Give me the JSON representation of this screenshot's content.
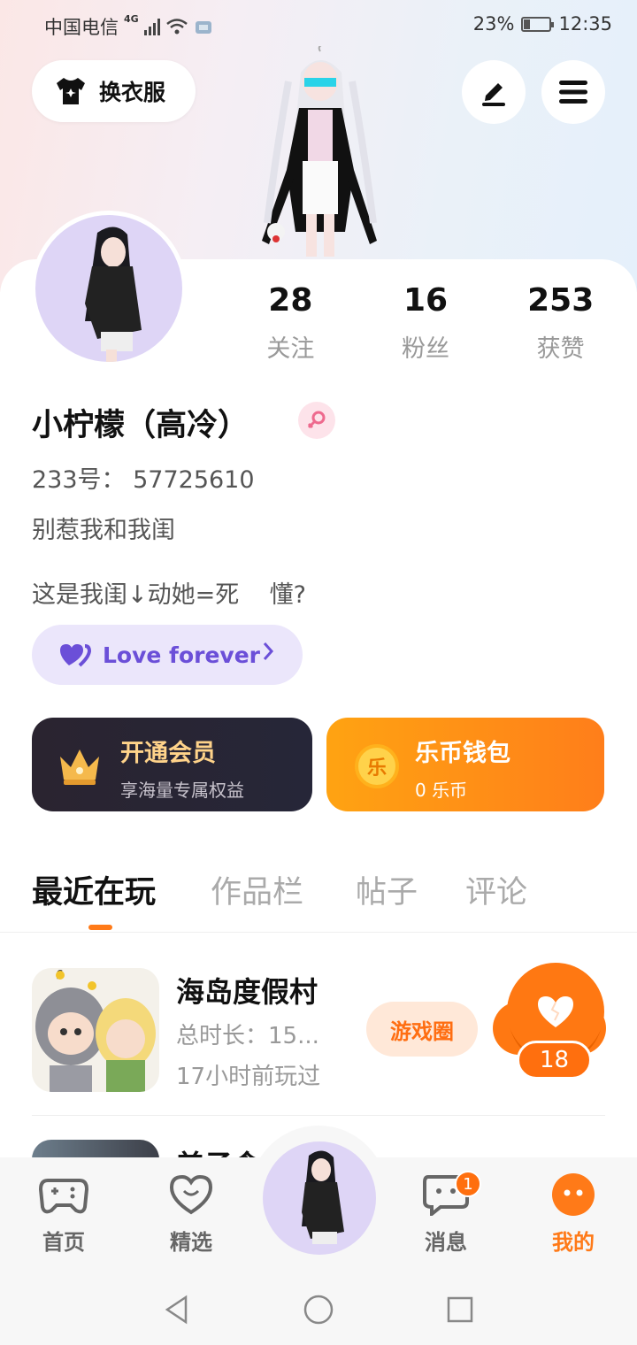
{
  "status_bar": {
    "carrier": "中国电信",
    "network": "4G",
    "battery": "23%",
    "time": "12:35"
  },
  "header": {
    "outfit_label": "换衣服"
  },
  "stats": [
    {
      "value": "28",
      "label": "关注"
    },
    {
      "value": "16",
      "label": "粉丝"
    },
    {
      "value": "253",
      "label": "获赞"
    }
  ],
  "profile": {
    "username": "小柠檬（高冷）",
    "uid": "233号： 57725610",
    "bio_line1": "别惹我和我闺",
    "bio_line2": "这是我闺↓动她=死    懂?",
    "relation_label": "Love forever"
  },
  "vip": {
    "title": "开通会员",
    "subtitle": "享海量专属权益"
  },
  "wallet": {
    "title": "乐币钱包",
    "subtitle": "0 乐币",
    "coin_glyph": "乐"
  },
  "tabs": [
    "最近在玩",
    "作品栏",
    "帖子",
    "评论"
  ],
  "games": [
    {
      "name": "海岛度假村",
      "time": "总时长：15...",
      "last_played": "17小时前玩过",
      "circle_label": "游戏圈"
    },
    {
      "name": "美子食"
    }
  ],
  "like_count": "18",
  "bottom_nav": {
    "home": "首页",
    "featured": "精选",
    "messages": "消息",
    "messages_badge": "1",
    "mine": "我的"
  },
  "colors": {
    "accent": "#ff7a18",
    "purple": "#6b4fd8",
    "vip_gold": "#ffd38a"
  }
}
